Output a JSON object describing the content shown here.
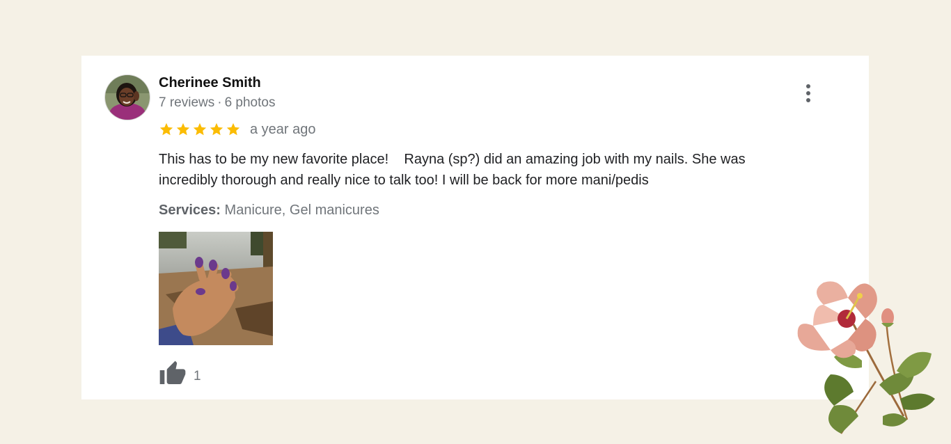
{
  "review": {
    "author": "Cherinee Smith",
    "reviews_count": "7 reviews",
    "meta_separator": "·",
    "photos_count": "6 photos",
    "rating": 5,
    "rating_max": 5,
    "time_ago": "a year ago",
    "text_lines": [
      "This has to be my new favorite place!    Rayna (sp?) did an amazing job with my nails. She was",
      "incredibly thorough and really nice to talk too! I will be back for more mani/pedis"
    ],
    "services_label": "Services:",
    "services_value": "Manicure, Gel manicures",
    "likes": "1",
    "more_icon": "more-vert-icon",
    "like_icon": "thumb-up-icon"
  },
  "colors": {
    "background": "#f5f1e6",
    "card": "#ffffff",
    "star": "#fbbc04",
    "muted_text": "#70757a",
    "body_text": "#202124"
  }
}
